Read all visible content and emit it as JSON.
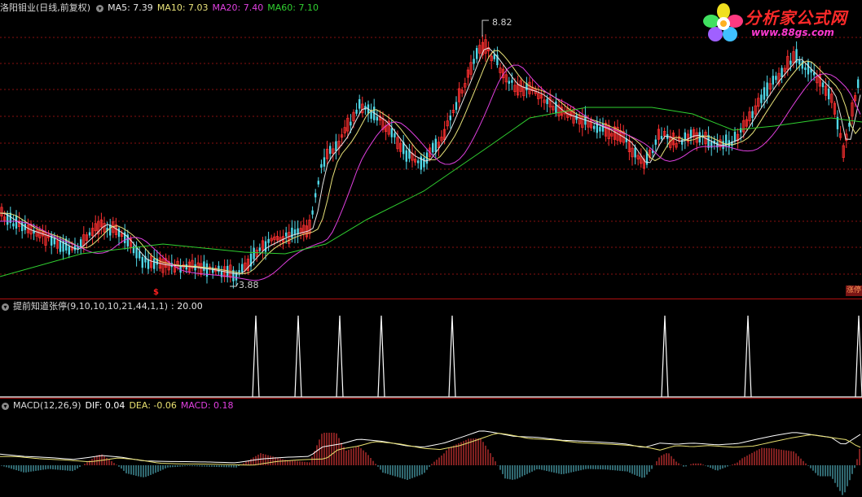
{
  "main": {
    "stock_name": "洛阳钼业",
    "period_info": "(日线,前复权)",
    "ma": [
      {
        "label": "MA5: 7.39",
        "color": "#e6e6e6"
      },
      {
        "label": "MA10: 7.03",
        "color": "#e8e27a"
      },
      {
        "label": "MA20: 7.40",
        "color": "#e040e0"
      },
      {
        "label": "MA60: 7.10",
        "color": "#30d030"
      }
    ],
    "high_label": "8.82",
    "low_label": "3.88",
    "edge_tag": "涨停",
    "signal_mark": "$"
  },
  "indicator": {
    "title": "提前知道张停(9,10,10,10,21,44,1,1)",
    "value": ": 20.00",
    "spike_count": 9
  },
  "macd": {
    "title": "MACD(12,26,9)",
    "dif": "DIF: 0.04",
    "dea": "DEA: -0.06",
    "macd_val": "MACD: 0.18"
  },
  "logo": {
    "title": "分析家公式网",
    "url": "www.88gs.com"
  },
  "colors": {
    "up": "#ff3030",
    "down": "#50d8e8",
    "grid": "#8a1010",
    "dif": "#ffffff",
    "dea": "#e8e070",
    "macd_pos": "#ff4040",
    "macd_neg": "#60d0e0"
  }
}
